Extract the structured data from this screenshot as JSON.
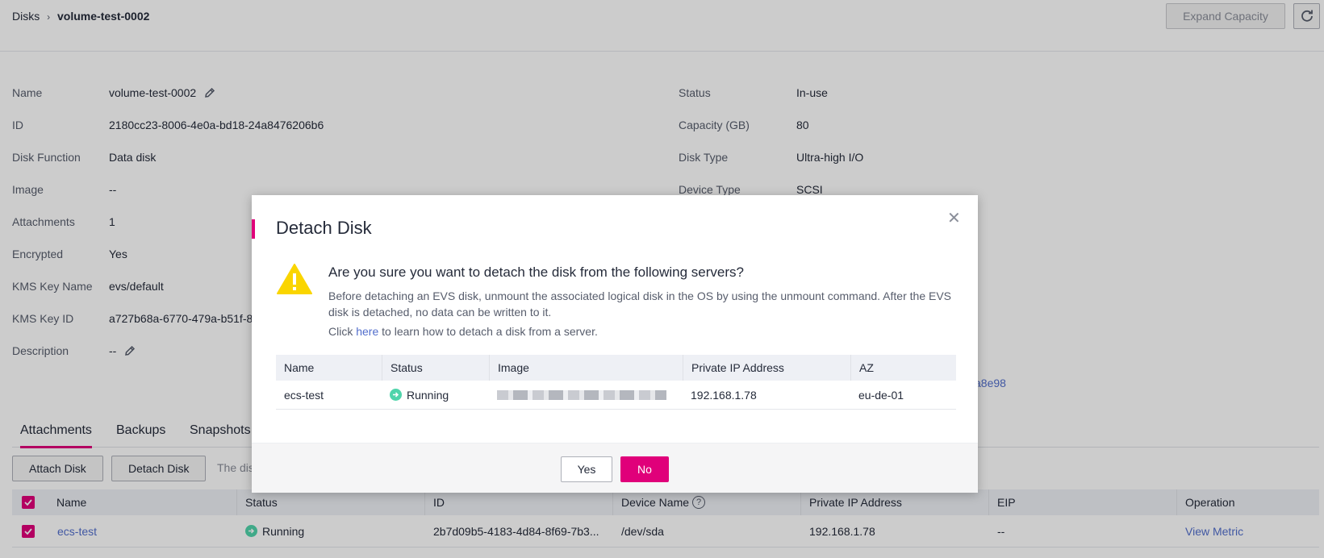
{
  "header": {
    "breadcrumb_root": "Disks",
    "breadcrumb_separator": "›",
    "breadcrumb_current": "volume-test-0002",
    "expand_button": "Expand Capacity",
    "refresh_icon": "refresh-icon"
  },
  "details": {
    "left": [
      {
        "label": "Name",
        "value": "volume-test-0002",
        "editable": true
      },
      {
        "label": "ID",
        "value": "2180cc23-8006-4e0a-bd18-24a8476206b6"
      },
      {
        "label": "Disk Function",
        "value": "Data disk"
      },
      {
        "label": "Image",
        "value": "--"
      },
      {
        "label": "Attachments",
        "value": "1"
      },
      {
        "label": "Encrypted",
        "value": "Yes"
      },
      {
        "label": "KMS Key Name",
        "value": "evs/default"
      },
      {
        "label": "KMS Key ID",
        "value": "a727b68a-6770-479a-b51f-8"
      },
      {
        "label": "Description",
        "value": "--",
        "editable": true
      }
    ],
    "right": [
      {
        "label": "Status",
        "value": "In-use"
      },
      {
        "label": "Capacity (GB)",
        "value": "80"
      },
      {
        "label": "Disk Type",
        "value": "Ultra-high I/O"
      },
      {
        "label": "Device Type",
        "value": "SCSI"
      }
    ],
    "partial_link": "a8e98"
  },
  "tabs": [
    "Attachments",
    "Backups",
    "Snapshots"
  ],
  "actions": {
    "attach": "Attach Disk",
    "detach": "Detach Disk",
    "hint": "The dis"
  },
  "table": {
    "headers": [
      "Name",
      "Status",
      "ID",
      "Device Name",
      "Private IP Address",
      "EIP",
      "Operation"
    ],
    "rows": [
      {
        "name": "ecs-test",
        "status": "Running",
        "id": "2b7d09b5-4183-4d84-8f69-7b3...",
        "device": "/dev/sda",
        "ip": "192.168.1.78",
        "eip": "--",
        "operation": "View Metric"
      }
    ]
  },
  "modal": {
    "title": "Detach Disk",
    "close_icon": "close-icon",
    "question": "Are you sure you want to detach the disk from the following servers?",
    "description": "Before detaching an EVS disk, unmount the associated logical disk in the OS by using the unmount command. After the EVS disk is detached, no data can be written to it.",
    "link_prefix": "Click",
    "link_text": "here",
    "link_suffix": "to learn how to detach a disk from a server.",
    "table_headers": [
      "Name",
      "Status",
      "Image",
      "Private IP Address",
      "AZ"
    ],
    "table_row": {
      "name": "ecs-test",
      "status": "Running",
      "ip": "192.168.1.78",
      "az": "eu-de-01"
    },
    "yes_button": "Yes",
    "no_button": "No"
  },
  "colors": {
    "accent": "#e0007a",
    "link": "#526ecc",
    "running": "#50d4ab",
    "warning": "#fad500"
  }
}
